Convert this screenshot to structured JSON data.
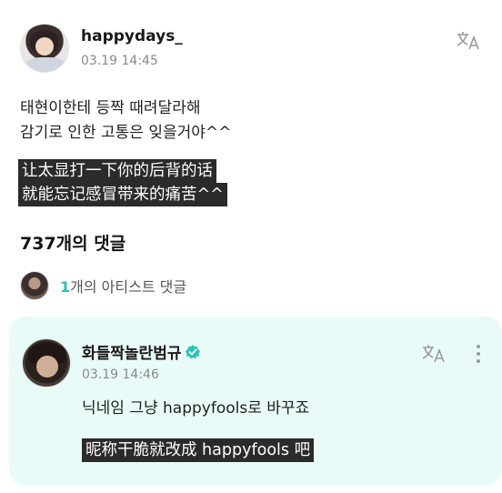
{
  "post": {
    "username": "happydays_",
    "timestamp": "03.19 14:45",
    "body_lines": [
      "태현이한테 등짝 때려달라해",
      "감기로 인한 고통은 잊을거야^^"
    ],
    "subtitle_lines": [
      "让太显打一下你的后背的话",
      "就能忘记感冒带来的痛苦^^"
    ]
  },
  "comments_summary": {
    "count_label": "737개의 댓글",
    "artist_count": "1",
    "artist_label": "개의 아티스트 댓글"
  },
  "comment": {
    "username": "화들짝놀란범규",
    "timestamp": "03.19 14:46",
    "text": "닉네임 그냥 happyfools로 바꾸죠",
    "subtitle": "昵称干脆就改成 happyfools 吧"
  },
  "icons": {
    "translate": "translate-icon",
    "verified": "verified-badge-icon",
    "more": "more-vertical-icon"
  },
  "colors": {
    "accent": "#2fbfb2",
    "card_bg": "#e9fbf8",
    "subtitle_bg": "#2b2b2b"
  }
}
